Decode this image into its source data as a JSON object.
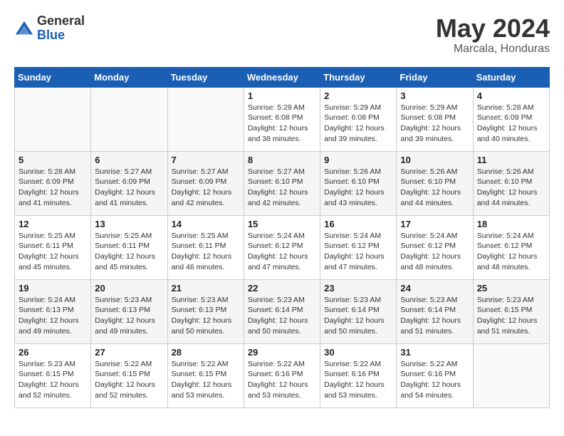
{
  "logo": {
    "general": "General",
    "blue": "Blue"
  },
  "title": {
    "month_year": "May 2024",
    "location": "Marcala, Honduras"
  },
  "weekdays": [
    "Sunday",
    "Monday",
    "Tuesday",
    "Wednesday",
    "Thursday",
    "Friday",
    "Saturday"
  ],
  "weeks": [
    [
      {
        "day": "",
        "sunrise": "",
        "sunset": "",
        "daylight": ""
      },
      {
        "day": "",
        "sunrise": "",
        "sunset": "",
        "daylight": ""
      },
      {
        "day": "",
        "sunrise": "",
        "sunset": "",
        "daylight": ""
      },
      {
        "day": "1",
        "sunrise": "Sunrise: 5:29 AM",
        "sunset": "Sunset: 6:08 PM",
        "daylight": "Daylight: 12 hours and 38 minutes."
      },
      {
        "day": "2",
        "sunrise": "Sunrise: 5:29 AM",
        "sunset": "Sunset: 6:08 PM",
        "daylight": "Daylight: 12 hours and 39 minutes."
      },
      {
        "day": "3",
        "sunrise": "Sunrise: 5:29 AM",
        "sunset": "Sunset: 6:08 PM",
        "daylight": "Daylight: 12 hours and 39 minutes."
      },
      {
        "day": "4",
        "sunrise": "Sunrise: 5:28 AM",
        "sunset": "Sunset: 6:09 PM",
        "daylight": "Daylight: 12 hours and 40 minutes."
      }
    ],
    [
      {
        "day": "5",
        "sunrise": "Sunrise: 5:28 AM",
        "sunset": "Sunset: 6:09 PM",
        "daylight": "Daylight: 12 hours and 41 minutes."
      },
      {
        "day": "6",
        "sunrise": "Sunrise: 5:27 AM",
        "sunset": "Sunset: 6:09 PM",
        "daylight": "Daylight: 12 hours and 41 minutes."
      },
      {
        "day": "7",
        "sunrise": "Sunrise: 5:27 AM",
        "sunset": "Sunset: 6:09 PM",
        "daylight": "Daylight: 12 hours and 42 minutes."
      },
      {
        "day": "8",
        "sunrise": "Sunrise: 5:27 AM",
        "sunset": "Sunset: 6:10 PM",
        "daylight": "Daylight: 12 hours and 42 minutes."
      },
      {
        "day": "9",
        "sunrise": "Sunrise: 5:26 AM",
        "sunset": "Sunset: 6:10 PM",
        "daylight": "Daylight: 12 hours and 43 minutes."
      },
      {
        "day": "10",
        "sunrise": "Sunrise: 5:26 AM",
        "sunset": "Sunset: 6:10 PM",
        "daylight": "Daylight: 12 hours and 44 minutes."
      },
      {
        "day": "11",
        "sunrise": "Sunrise: 5:26 AM",
        "sunset": "Sunset: 6:10 PM",
        "daylight": "Daylight: 12 hours and 44 minutes."
      }
    ],
    [
      {
        "day": "12",
        "sunrise": "Sunrise: 5:25 AM",
        "sunset": "Sunset: 6:11 PM",
        "daylight": "Daylight: 12 hours and 45 minutes."
      },
      {
        "day": "13",
        "sunrise": "Sunrise: 5:25 AM",
        "sunset": "Sunset: 6:11 PM",
        "daylight": "Daylight: 12 hours and 45 minutes."
      },
      {
        "day": "14",
        "sunrise": "Sunrise: 5:25 AM",
        "sunset": "Sunset: 6:11 PM",
        "daylight": "Daylight: 12 hours and 46 minutes."
      },
      {
        "day": "15",
        "sunrise": "Sunrise: 5:24 AM",
        "sunset": "Sunset: 6:12 PM",
        "daylight": "Daylight: 12 hours and 47 minutes."
      },
      {
        "day": "16",
        "sunrise": "Sunrise: 5:24 AM",
        "sunset": "Sunset: 6:12 PM",
        "daylight": "Daylight: 12 hours and 47 minutes."
      },
      {
        "day": "17",
        "sunrise": "Sunrise: 5:24 AM",
        "sunset": "Sunset: 6:12 PM",
        "daylight": "Daylight: 12 hours and 48 minutes."
      },
      {
        "day": "18",
        "sunrise": "Sunrise: 5:24 AM",
        "sunset": "Sunset: 6:12 PM",
        "daylight": "Daylight: 12 hours and 48 minutes."
      }
    ],
    [
      {
        "day": "19",
        "sunrise": "Sunrise: 5:24 AM",
        "sunset": "Sunset: 6:13 PM",
        "daylight": "Daylight: 12 hours and 49 minutes."
      },
      {
        "day": "20",
        "sunrise": "Sunrise: 5:23 AM",
        "sunset": "Sunset: 6:13 PM",
        "daylight": "Daylight: 12 hours and 49 minutes."
      },
      {
        "day": "21",
        "sunrise": "Sunrise: 5:23 AM",
        "sunset": "Sunset: 6:13 PM",
        "daylight": "Daylight: 12 hours and 50 minutes."
      },
      {
        "day": "22",
        "sunrise": "Sunrise: 5:23 AM",
        "sunset": "Sunset: 6:14 PM",
        "daylight": "Daylight: 12 hours and 50 minutes."
      },
      {
        "day": "23",
        "sunrise": "Sunrise: 5:23 AM",
        "sunset": "Sunset: 6:14 PM",
        "daylight": "Daylight: 12 hours and 50 minutes."
      },
      {
        "day": "24",
        "sunrise": "Sunrise: 5:23 AM",
        "sunset": "Sunset: 6:14 PM",
        "daylight": "Daylight: 12 hours and 51 minutes."
      },
      {
        "day": "25",
        "sunrise": "Sunrise: 5:23 AM",
        "sunset": "Sunset: 6:15 PM",
        "daylight": "Daylight: 12 hours and 51 minutes."
      }
    ],
    [
      {
        "day": "26",
        "sunrise": "Sunrise: 5:23 AM",
        "sunset": "Sunset: 6:15 PM",
        "daylight": "Daylight: 12 hours and 52 minutes."
      },
      {
        "day": "27",
        "sunrise": "Sunrise: 5:22 AM",
        "sunset": "Sunset: 6:15 PM",
        "daylight": "Daylight: 12 hours and 52 minutes."
      },
      {
        "day": "28",
        "sunrise": "Sunrise: 5:22 AM",
        "sunset": "Sunset: 6:15 PM",
        "daylight": "Daylight: 12 hours and 53 minutes."
      },
      {
        "day": "29",
        "sunrise": "Sunrise: 5:22 AM",
        "sunset": "Sunset: 6:16 PM",
        "daylight": "Daylight: 12 hours and 53 minutes."
      },
      {
        "day": "30",
        "sunrise": "Sunrise: 5:22 AM",
        "sunset": "Sunset: 6:16 PM",
        "daylight": "Daylight: 12 hours and 53 minutes."
      },
      {
        "day": "31",
        "sunrise": "Sunrise: 5:22 AM",
        "sunset": "Sunset: 6:16 PM",
        "daylight": "Daylight: 12 hours and 54 minutes."
      },
      {
        "day": "",
        "sunrise": "",
        "sunset": "",
        "daylight": ""
      }
    ]
  ]
}
